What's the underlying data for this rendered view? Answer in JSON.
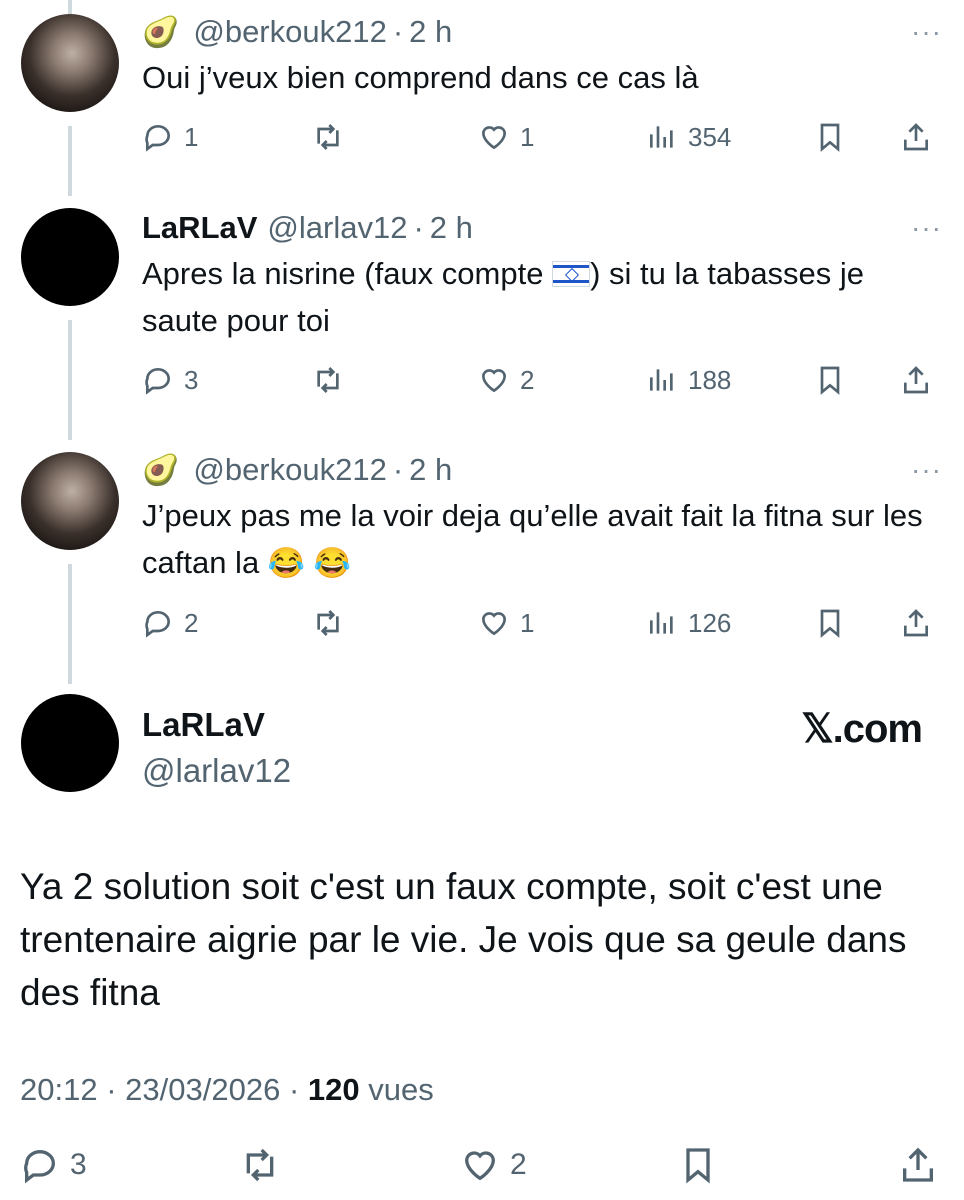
{
  "replies": [
    {
      "emoji": "🥑",
      "name": "",
      "handle": "@berkouk212",
      "time": "2 h",
      "text": "Oui j’veux bien comprend dans ce cas là",
      "replies": "1",
      "retweets": "",
      "likes": "1",
      "views": "354"
    },
    {
      "emoji": "",
      "name": "LaRLaV",
      "handle": "@larlav12",
      "time": "2 h",
      "text_before_flag": "Apres la nisrine (faux compte ",
      "text_after_flag": ") si tu la tabasses je saute pour toi",
      "replies": "3",
      "retweets": "",
      "likes": "2",
      "views": "188"
    },
    {
      "emoji": "🥑",
      "name": "",
      "handle": "@berkouk212",
      "time": "2 h",
      "text": "J’peux pas me la voir deja qu’elle avait fait la fitna sur les caftan la",
      "laughs": "😂 😂",
      "replies": "2",
      "retweets": "",
      "likes": "1",
      "views": "126"
    }
  ],
  "main": {
    "name": "LaRLaV",
    "handle": "@larlav12",
    "watermark": "𝕏.com",
    "text": "Ya 2 solution soit c'est un faux compte, soit c'est une trentenaire aigrie par le vie. Je vois que sa geule dans des fitna",
    "time": "20:12",
    "date": "23/03/2026",
    "views_count": "120",
    "views_label": "vues",
    "replies": "3",
    "likes": "2"
  },
  "separator": "·",
  "more": "···"
}
